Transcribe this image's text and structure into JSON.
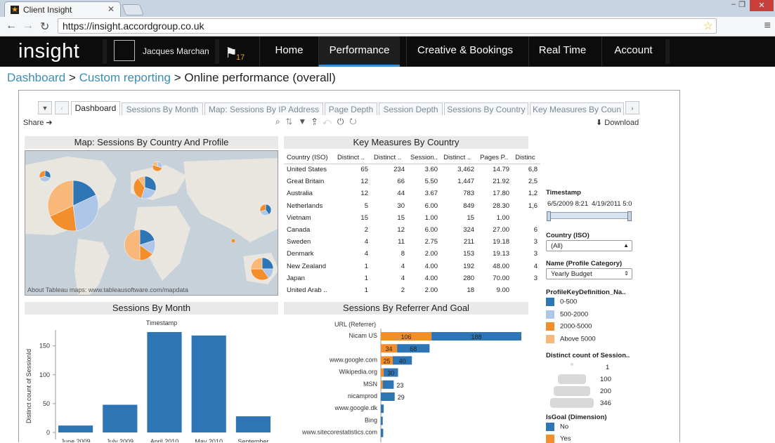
{
  "browser": {
    "tab_title": "Client Insight",
    "url": "https://insight.accordgroup.co.uk"
  },
  "nav": {
    "logo": "insight",
    "user": "Jacques Marchan",
    "flag_count": "17",
    "items": [
      "Home",
      "Performance",
      "Creative & Bookings",
      "Real Time",
      "Account"
    ],
    "active": "Performance"
  },
  "breadcrumb": {
    "dashboard": "Dashboard",
    "custom": "Custom reporting",
    "current": "Online performance (overall)"
  },
  "worksheet_tabs": [
    "Dashboard",
    "Sessions By Month",
    "Map: Sessions By IP Address",
    "Page Depth",
    "Session Depth",
    "Sessions By Country",
    "Key Measures By Coun"
  ],
  "toolbar": {
    "share": "Share",
    "download": "Download"
  },
  "map": {
    "title": "Map: Sessions By Country And Profile",
    "credit": "About Tableau maps: www.tableausoftware.com/mapdata"
  },
  "key_measures": {
    "title": "Key Measures By Country",
    "headers": [
      "Country (ISO)",
      "Distinct ..",
      "Distinct ..",
      "Session..",
      "Distinct ..",
      "Pages P..",
      "Distinc"
    ],
    "rows": [
      [
        "United States",
        "65",
        "234",
        "3.60",
        "3,462",
        "14.79",
        "6,8"
      ],
      [
        "Great Britain",
        "12",
        "66",
        "5.50",
        "1,447",
        "21.92",
        "2,5"
      ],
      [
        "Australia",
        "12",
        "44",
        "3.67",
        "783",
        "17.80",
        "1,2"
      ],
      [
        "Netherlands",
        "5",
        "30",
        "6.00",
        "849",
        "28.30",
        "1,6"
      ],
      [
        "Vietnam",
        "15",
        "15",
        "1.00",
        "15",
        "1.00",
        ""
      ],
      [
        "Canada",
        "2",
        "12",
        "6.00",
        "324",
        "27.00",
        "6"
      ],
      [
        "Sweden",
        "4",
        "11",
        "2.75",
        "211",
        "19.18",
        "3"
      ],
      [
        "Denmark",
        "4",
        "8",
        "2.00",
        "153",
        "19.13",
        "3"
      ],
      [
        "New Zealand",
        "1",
        "4",
        "4.00",
        "192",
        "48.00",
        "4"
      ],
      [
        "Japan",
        "1",
        "4",
        "4.00",
        "280",
        "70.00",
        "3"
      ],
      [
        "United Arab ..",
        "1",
        "2",
        "2.00",
        "18",
        "9.00",
        ""
      ]
    ]
  },
  "filters": {
    "timestamp_label": "Timestamp",
    "timestamp_from": "6/5/2009 8:21",
    "timestamp_to": "4/19/2011 5:0",
    "country_label": "Country (ISO)",
    "country_value": "(All)",
    "profile_label": "Name (Profile Category)",
    "profile_value": "Yearly Budget"
  },
  "legend": {
    "profile_title": "ProfileKeyDefinition_Na..",
    "profile_items": [
      {
        "label": "0-500",
        "color": "#2e75b6"
      },
      {
        "label": "500-2000",
        "color": "#aec7e8"
      },
      {
        "label": "2000-5000",
        "color": "#f28e2b"
      },
      {
        "label": "Above 5000",
        "color": "#f7b87a"
      }
    ],
    "size_title": "Distinct count of Session..",
    "size_items": [
      "1",
      "100",
      "200",
      "346"
    ],
    "goal_title": "IsGoal (Dimension)",
    "goal_items": [
      {
        "label": "No",
        "color": "#2e75b6"
      },
      {
        "label": "Yes",
        "color": "#f28e2b"
      }
    ]
  },
  "chart_data": [
    {
      "type": "bar",
      "title": "Sessions By Month",
      "xlabel": "Timestamp",
      "ylabel": "Distinct count of SessionId",
      "categories": [
        "June 2009",
        "July 2009",
        "April 2010",
        "May 2010",
        "September"
      ],
      "values": [
        12,
        48,
        174,
        168,
        28
      ],
      "ylim": [
        0,
        180
      ],
      "yticks": [
        0,
        50,
        100,
        150
      ],
      "color": "#2e75b6"
    },
    {
      "type": "bar",
      "title": "Sessions By Referrer And Goal",
      "ylabel": "URL (Referrer)",
      "orientation": "horizontal",
      "categories": [
        "Nicam US",
        "",
        "www.google.com",
        "Wikipedia.org",
        "MSN",
        "nicamprod",
        "www.google.dk",
        "Bing",
        "www.sitecorestatistics.com"
      ],
      "series": [
        {
          "name": "Yes",
          "values": [
            106,
            34,
            25,
            6,
            4,
            0,
            0,
            0,
            0
          ]
        },
        {
          "name": "No",
          "values": [
            188,
            68,
            40,
            30,
            23,
            29,
            6,
            4,
            5
          ]
        }
      ],
      "labels_yes": [
        "106",
        "34",
        "25",
        "",
        "",
        "",
        "",
        "",
        ""
      ],
      "labels_no": [
        "188",
        "68",
        "40",
        "30",
        "23",
        "29",
        "",
        "",
        ""
      ]
    }
  ]
}
